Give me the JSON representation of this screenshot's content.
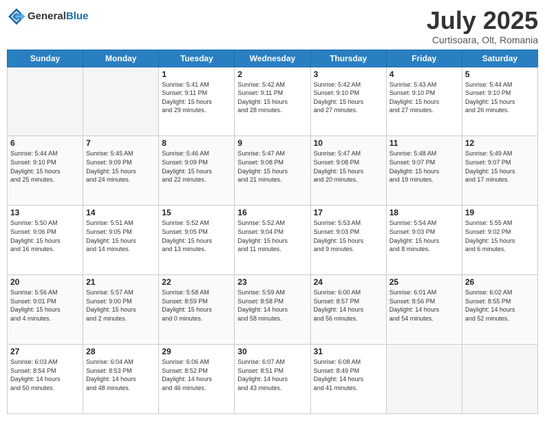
{
  "header": {
    "logo_general": "General",
    "logo_blue": "Blue",
    "month": "July 2025",
    "location": "Curtisoara, Olt, Romania"
  },
  "days_of_week": [
    "Sunday",
    "Monday",
    "Tuesday",
    "Wednesday",
    "Thursday",
    "Friday",
    "Saturday"
  ],
  "weeks": [
    [
      {
        "day": "",
        "detail": ""
      },
      {
        "day": "",
        "detail": ""
      },
      {
        "day": "1",
        "detail": "Sunrise: 5:41 AM\nSunset: 9:11 PM\nDaylight: 15 hours\nand 29 minutes."
      },
      {
        "day": "2",
        "detail": "Sunrise: 5:42 AM\nSunset: 9:11 PM\nDaylight: 15 hours\nand 28 minutes."
      },
      {
        "day": "3",
        "detail": "Sunrise: 5:42 AM\nSunset: 9:10 PM\nDaylight: 15 hours\nand 27 minutes."
      },
      {
        "day": "4",
        "detail": "Sunrise: 5:43 AM\nSunset: 9:10 PM\nDaylight: 15 hours\nand 27 minutes."
      },
      {
        "day": "5",
        "detail": "Sunrise: 5:44 AM\nSunset: 9:10 PM\nDaylight: 15 hours\nand 26 minutes."
      }
    ],
    [
      {
        "day": "6",
        "detail": "Sunrise: 5:44 AM\nSunset: 9:10 PM\nDaylight: 15 hours\nand 25 minutes."
      },
      {
        "day": "7",
        "detail": "Sunrise: 5:45 AM\nSunset: 9:09 PM\nDaylight: 15 hours\nand 24 minutes."
      },
      {
        "day": "8",
        "detail": "Sunrise: 5:46 AM\nSunset: 9:09 PM\nDaylight: 15 hours\nand 22 minutes."
      },
      {
        "day": "9",
        "detail": "Sunrise: 5:47 AM\nSunset: 9:08 PM\nDaylight: 15 hours\nand 21 minutes."
      },
      {
        "day": "10",
        "detail": "Sunrise: 5:47 AM\nSunset: 9:08 PM\nDaylight: 15 hours\nand 20 minutes."
      },
      {
        "day": "11",
        "detail": "Sunrise: 5:48 AM\nSunset: 9:07 PM\nDaylight: 15 hours\nand 19 minutes."
      },
      {
        "day": "12",
        "detail": "Sunrise: 5:49 AM\nSunset: 9:07 PM\nDaylight: 15 hours\nand 17 minutes."
      }
    ],
    [
      {
        "day": "13",
        "detail": "Sunrise: 5:50 AM\nSunset: 9:06 PM\nDaylight: 15 hours\nand 16 minutes."
      },
      {
        "day": "14",
        "detail": "Sunrise: 5:51 AM\nSunset: 9:05 PM\nDaylight: 15 hours\nand 14 minutes."
      },
      {
        "day": "15",
        "detail": "Sunrise: 5:52 AM\nSunset: 9:05 PM\nDaylight: 15 hours\nand 13 minutes."
      },
      {
        "day": "16",
        "detail": "Sunrise: 5:52 AM\nSunset: 9:04 PM\nDaylight: 15 hours\nand 11 minutes."
      },
      {
        "day": "17",
        "detail": "Sunrise: 5:53 AM\nSunset: 9:03 PM\nDaylight: 15 hours\nand 9 minutes."
      },
      {
        "day": "18",
        "detail": "Sunrise: 5:54 AM\nSunset: 9:03 PM\nDaylight: 15 hours\nand 8 minutes."
      },
      {
        "day": "19",
        "detail": "Sunrise: 5:55 AM\nSunset: 9:02 PM\nDaylight: 15 hours\nand 6 minutes."
      }
    ],
    [
      {
        "day": "20",
        "detail": "Sunrise: 5:56 AM\nSunset: 9:01 PM\nDaylight: 15 hours\nand 4 minutes."
      },
      {
        "day": "21",
        "detail": "Sunrise: 5:57 AM\nSunset: 9:00 PM\nDaylight: 15 hours\nand 2 minutes."
      },
      {
        "day": "22",
        "detail": "Sunrise: 5:58 AM\nSunset: 8:59 PM\nDaylight: 15 hours\nand 0 minutes."
      },
      {
        "day": "23",
        "detail": "Sunrise: 5:59 AM\nSunset: 8:58 PM\nDaylight: 14 hours\nand 58 minutes."
      },
      {
        "day": "24",
        "detail": "Sunrise: 6:00 AM\nSunset: 8:57 PM\nDaylight: 14 hours\nand 56 minutes."
      },
      {
        "day": "25",
        "detail": "Sunrise: 6:01 AM\nSunset: 8:56 PM\nDaylight: 14 hours\nand 54 minutes."
      },
      {
        "day": "26",
        "detail": "Sunrise: 6:02 AM\nSunset: 8:55 PM\nDaylight: 14 hours\nand 52 minutes."
      }
    ],
    [
      {
        "day": "27",
        "detail": "Sunrise: 6:03 AM\nSunset: 8:54 PM\nDaylight: 14 hours\nand 50 minutes."
      },
      {
        "day": "28",
        "detail": "Sunrise: 6:04 AM\nSunset: 8:53 PM\nDaylight: 14 hours\nand 48 minutes."
      },
      {
        "day": "29",
        "detail": "Sunrise: 6:06 AM\nSunset: 8:52 PM\nDaylight: 14 hours\nand 46 minutes."
      },
      {
        "day": "30",
        "detail": "Sunrise: 6:07 AM\nSunset: 8:51 PM\nDaylight: 14 hours\nand 43 minutes."
      },
      {
        "day": "31",
        "detail": "Sunrise: 6:08 AM\nSunset: 8:49 PM\nDaylight: 14 hours\nand 41 minutes."
      },
      {
        "day": "",
        "detail": ""
      },
      {
        "day": "",
        "detail": ""
      }
    ]
  ]
}
